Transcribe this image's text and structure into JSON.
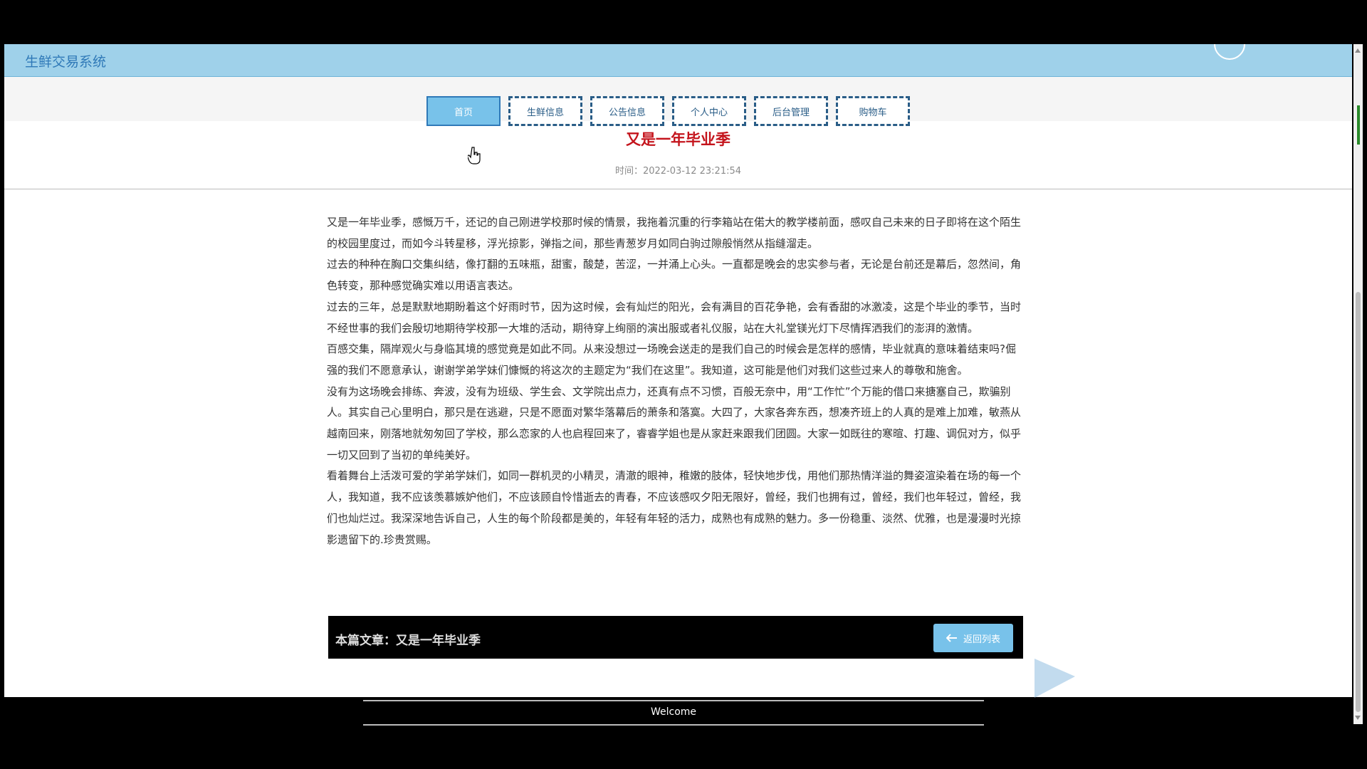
{
  "header": {
    "title": "生鲜交易系统"
  },
  "nav": [
    {
      "label": "首页",
      "active": true
    },
    {
      "label": "生鲜信息",
      "active": false
    },
    {
      "label": "公告信息",
      "active": false
    },
    {
      "label": "个人中心",
      "active": false
    },
    {
      "label": "后台管理",
      "active": false
    },
    {
      "label": "购物车",
      "active": false
    }
  ],
  "article": {
    "title": "又是一年毕业季",
    "time": "时间：2022-03-12 23:21:54",
    "paragraphs": [
      "又是一年毕业季，感慨万千，还记的自己刚进学校那时候的情景，我拖着沉重的行李箱站在偌大的教学楼前面，感叹自己未来的日子即将在这个陌生的校园里度过，而如今斗转星移，浮光掠影，弹指之间，那些青葱岁月如同白驹过隙般悄然从指缝溜走。",
      "过去的种种在胸口交集纠结，像打翻的五味瓶，甜蜜，酸楚，苦涩，一并涌上心头。一直都是晚会的忠实参与者，无论是台前还是幕后，忽然间，角色转变，那种感觉确实难以用语言表达。",
      "过去的三年，总是默默地期盼着这个好雨时节，因为这时候，会有灿烂的阳光，会有满目的百花争艳，会有香甜的冰激凌，这是个毕业的季节，当时不经世事的我们会殷切地期待学校那一大堆的活动，期待穿上绚丽的演出服或者礼仪服，站在大礼堂镁光灯下尽情挥洒我们的澎湃的激情。",
      "百感交集，隔岸观火与身临其境的感觉竟是如此不同。从来没想过一场晚会送走的是我们自己的时候会是怎样的感情，毕业就真的意味着结束吗?倔强的我们不愿意承认，谢谢学弟学妹们慷慨的将这次的主题定为“我们在这里”。我知道，这可能是他们对我们这些过来人的尊敬和施舍。",
      "没有为这场晚会排练、奔波，没有为班级、学生会、文学院出点力，还真有点不习惯，百般无奈中，用“工作忙”个万能的借口来搪塞自己，欺骗别人。其实自己心里明白，那只是在逃避，只是不愿面对繁华落幕后的萧条和落寞。大四了，大家各奔东西，想凑齐班上的人真的是难上加难，敏燕从越南回来，刚落地就匆匆回了学校，那么恋家的人也启程回来了，睿睿学姐也是从家赶来跟我们团圆。大家一如既往的寒暄、打趣、调侃对方，似乎一切又回到了当初的单纯美好。",
      "看着舞台上活泼可爱的学弟学妹们，如同一群机灵的小精灵，清澈的眼神，稚嫩的肢体，轻快地步伐，用他们那热情洋溢的舞姿渲染着在场的每一个人，我知道，我不应该羡慕嫉妒他们，不应该顾自怜惜逝去的青春，不应该感叹夕阳无限好，曾经，我们也拥有过，曾经，我们也年轻过，曾经，我们也灿烂过。我深深地告诉自己，人生的每个阶段都是美的，年轻有年轻的活力，成熟也有成熟的魅力。多一份稳重、淡然、优雅，也是漫漫时光掠影遗留下的.珍贵赏赐。"
    ]
  },
  "bottom_bar": {
    "label": "本篇文章：又是一年毕业季",
    "back_button": "返回列表"
  },
  "footer": {
    "text": "Welcome"
  }
}
